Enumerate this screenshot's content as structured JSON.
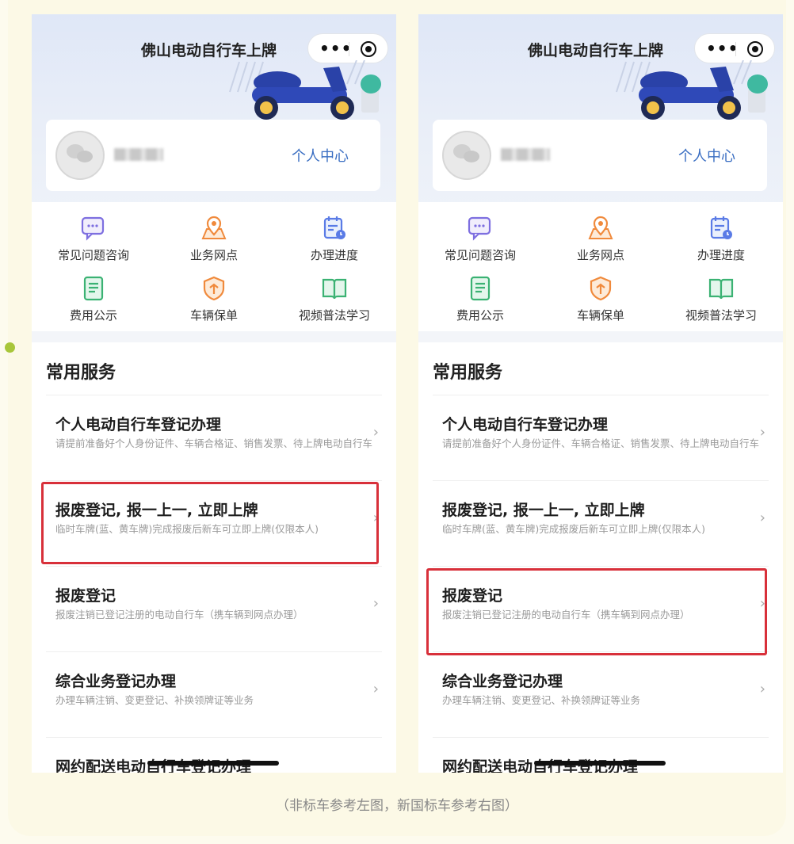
{
  "app_title": "佛山电动自行车上牌",
  "capsule": {
    "more": "•••"
  },
  "profile": {
    "center_link": "个人中心"
  },
  "quick_icons": [
    {
      "label": "常见问题咨询",
      "icon": "chat-bubble-icon",
      "color": "#7e6fe0"
    },
    {
      "label": "业务网点",
      "icon": "map-pin-icon",
      "color": "#f08a3c"
    },
    {
      "label": "办理进度",
      "icon": "calendar-clock-icon",
      "color": "#5a7be6"
    },
    {
      "label": "费用公示",
      "icon": "document-icon",
      "color": "#3bb273"
    },
    {
      "label": "车辆保单",
      "icon": "shield-icon",
      "color": "#f08a3c"
    },
    {
      "label": "视频普法学习",
      "icon": "book-icon",
      "color": "#3bb273"
    }
  ],
  "services": {
    "title": "常用服务",
    "items": [
      {
        "title": "个人电动自行车登记办理",
        "desc": "请提前准备好个人身份证件、车辆合格证、销售发票、待上牌电动自行车"
      },
      {
        "title": "报废登记, 报一上一, 立即上牌",
        "desc": "临时车牌(蓝、黄车牌)完成报废后新车可立即上牌(仅限本人)"
      },
      {
        "title": "报废登记",
        "desc": "报废注销已登记注册的电动自行车（携车辆到网点办理）"
      },
      {
        "title": "综合业务登记办理",
        "desc": "办理车辆注销、变更登记、补换领牌证等业务"
      },
      {
        "title": "网约配送电动自行车登记办理",
        "desc": ""
      }
    ]
  },
  "highlights": {
    "left_item": 2,
    "right_item": 3,
    "color": "#d8303a"
  },
  "caption": "（非标车参考左图，新国标车参考右图）"
}
